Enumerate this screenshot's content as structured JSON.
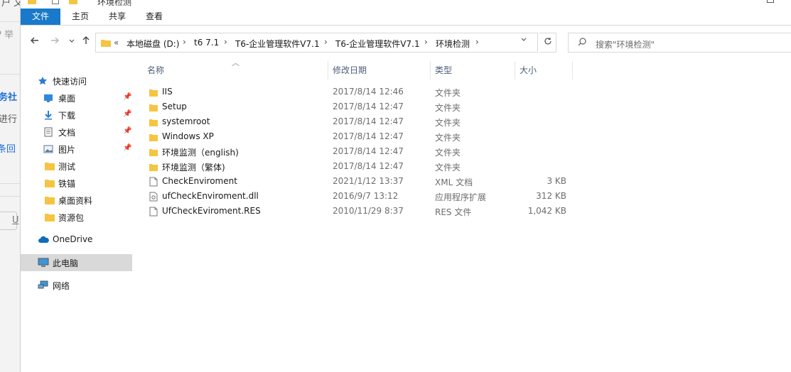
{
  "background_window": {
    "fragments": [
      "户 文",
      "P 举",
      "务社",
      "进行",
      "条回",
      "U"
    ]
  },
  "titlebar": {
    "title": "环境检测"
  },
  "ribbon": {
    "tabs": [
      "文件",
      "主页",
      "共享",
      "查看"
    ]
  },
  "address": {
    "overflow": "«",
    "crumbs": [
      "本地磁盘 (D:)",
      "t6 7.1",
      "T6-企业管理软件V7.1",
      "T6-企业管理软件V7.1",
      "环境检测"
    ],
    "separator": "›"
  },
  "search": {
    "placeholder": "搜索\"环境检测\""
  },
  "nav": {
    "quick_access": "快速访问",
    "quick_items": [
      {
        "label": "桌面",
        "icon": "desktop-icon",
        "pinned": true
      },
      {
        "label": "下载",
        "icon": "download-icon",
        "pinned": true
      },
      {
        "label": "文档",
        "icon": "document-icon",
        "pinned": true
      },
      {
        "label": "图片",
        "icon": "picture-icon",
        "pinned": true
      },
      {
        "label": "测试",
        "icon": "folder-icon",
        "pinned": false
      },
      {
        "label": "铁锚",
        "icon": "folder-icon",
        "pinned": false
      },
      {
        "label": "桌面资料",
        "icon": "folder-icon",
        "pinned": false
      },
      {
        "label": "资源包",
        "icon": "folder-icon",
        "pinned": false
      }
    ],
    "onedrive": "OneDrive",
    "this_pc": "此电脑",
    "network": "网络"
  },
  "columns": {
    "name": "名称",
    "date": "修改日期",
    "type": "类型",
    "size": "大小"
  },
  "files": [
    {
      "name": "IIS",
      "date": "2017/8/14 12:46",
      "type": "文件夹",
      "size": "",
      "kind": "folder"
    },
    {
      "name": "Setup",
      "date": "2017/8/14 12:47",
      "type": "文件夹",
      "size": "",
      "kind": "folder"
    },
    {
      "name": "systemroot",
      "date": "2017/8/14 12:47",
      "type": "文件夹",
      "size": "",
      "kind": "folder"
    },
    {
      "name": "Windows XP",
      "date": "2017/8/14 12:47",
      "type": "文件夹",
      "size": "",
      "kind": "folder"
    },
    {
      "name": "环境监测（english)",
      "date": "2017/8/14 12:47",
      "type": "文件夹",
      "size": "",
      "kind": "folder"
    },
    {
      "name": "环境监测（繁体)",
      "date": "2017/8/14 12:47",
      "type": "文件夹",
      "size": "",
      "kind": "folder"
    },
    {
      "name": "CheckEnviroment",
      "date": "2021/1/12 13:37",
      "type": "XML 文档",
      "size": "3 KB",
      "kind": "file"
    },
    {
      "name": "ufCheckEnviroment.dll",
      "date": "2016/9/7 13:12",
      "type": "应用程序扩展",
      "size": "312 KB",
      "kind": "dll"
    },
    {
      "name": "UfCheckEviroment.RES",
      "date": "2010/11/29 8:37",
      "type": "RES 文件",
      "size": "1,042 KB",
      "kind": "file"
    }
  ],
  "colors": {
    "accent": "#1979ca",
    "folder": "#f5c542",
    "selected_bg": "#d9d9d9"
  }
}
